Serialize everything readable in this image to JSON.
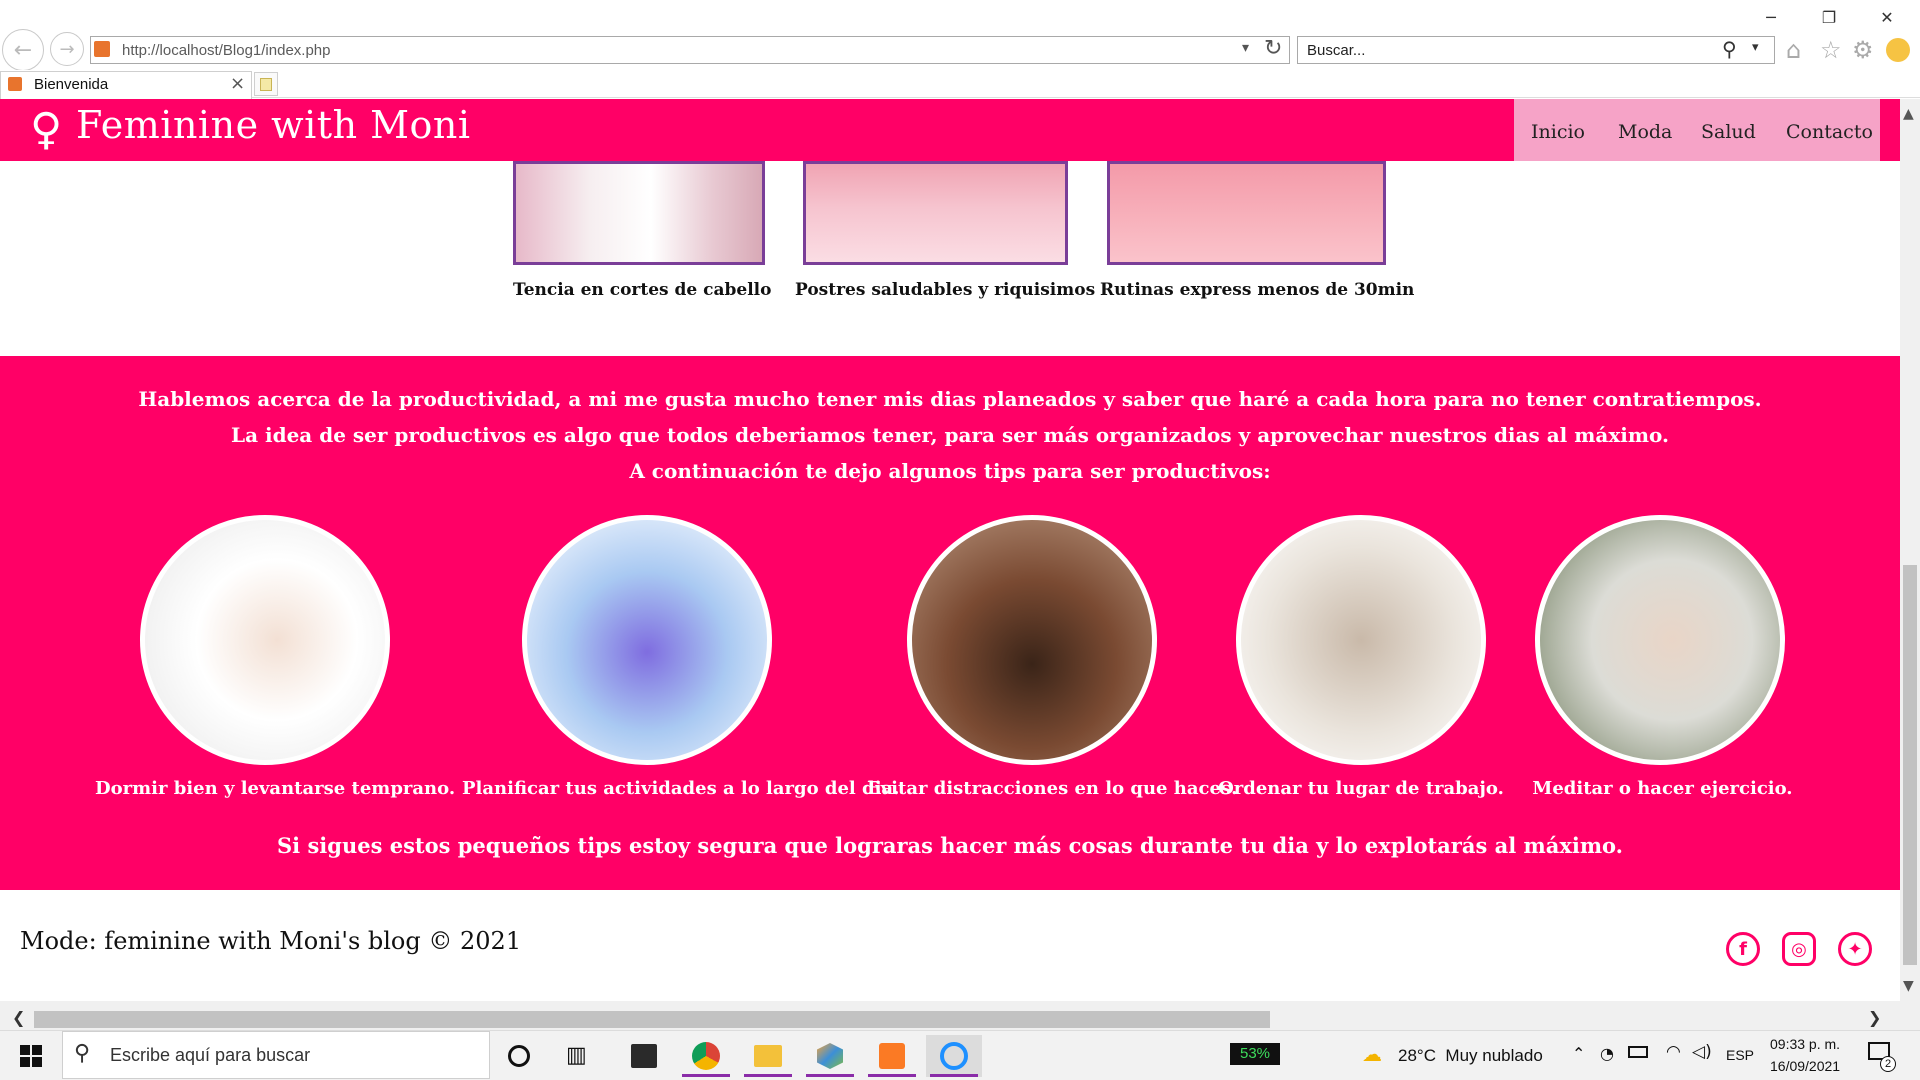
{
  "browser": {
    "url": "http://localhost/Blog1/index.php",
    "search_placeholder": "Buscar...",
    "tab_title": "Bienvenida"
  },
  "site": {
    "logo_symbol": "♀",
    "logo_text": "Feminine with Moni",
    "nav": [
      "Inicio",
      "Moda",
      "Salud",
      "Contacto"
    ]
  },
  "thumbnails": [
    {
      "label": "Tencia en cortes de cabello"
    },
    {
      "label": "Postres saludables y riquisimos"
    },
    {
      "label": "Rutinas express menos de 30min"
    }
  ],
  "productivity": {
    "intro_lines": [
      "Hablemos acerca de la productividad, a mi me gusta mucho tener mis dias planeados y saber que haré a cada hora para no tener contratiempos.",
      "La idea de ser productivos es algo que todos deberiamos tener, para ser más organizados y aprovechar nuestros dias al máximo.",
      "A continuación te dejo algunos tips para ser productivos:"
    ],
    "tips": [
      {
        "label": "Dormir bien y levantarse temprano."
      },
      {
        "label": "Planificar tus actividades a lo largo del dia."
      },
      {
        "label": "Evitar distracciones en lo que haces."
      },
      {
        "label": "Ordenar tu lugar de trabajo."
      },
      {
        "label": "Meditar o hacer ejercicio."
      }
    ],
    "closing": "Si sigues estos pequeños tips estoy segura que lograras hacer más cosas durante tu dia y lo explotarás al máximo."
  },
  "footer": {
    "text": "Mode: feminine with Moni's blog © 2021",
    "social": [
      "facebook-icon",
      "instagram-icon",
      "twitter-icon"
    ]
  },
  "taskbar": {
    "search_placeholder": "Escribe aquí para buscar",
    "battery": "53%",
    "weather": "28°C  Muy nublado",
    "language": "ESP",
    "time": "09:33 p. m.",
    "date": "16/09/2021",
    "notifications": "2"
  },
  "colors": {
    "brand_pink": "#ff0066",
    "nav_pink": "#f6a3c7",
    "thumb_border": "#7a3e98"
  }
}
